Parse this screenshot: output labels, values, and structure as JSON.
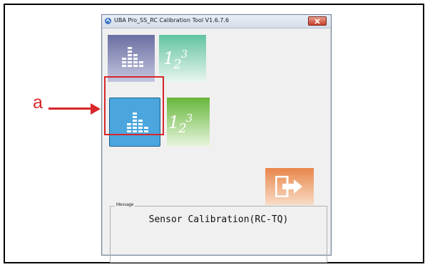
{
  "window": {
    "title": "UBA Pro_SS_RC Calibration Tool V1.6.7.6",
    "close_icon": "close-icon"
  },
  "tiles": [
    {
      "name": "sensor-calibration-tile-rc-tc",
      "icon": "bar-chart-icon"
    },
    {
      "name": "numeric-tile-rc-tc",
      "icon": "number-123-icon",
      "text": "123"
    },
    {
      "name": "sensor-calibration-tile-rc-tq",
      "icon": "bar-chart-icon",
      "selected": true
    },
    {
      "name": "numeric-tile-rc-tq",
      "icon": "number-123-icon",
      "text": "123"
    },
    {
      "name": "exit-tile",
      "icon": "exit-icon"
    }
  ],
  "message": {
    "legend": "Message",
    "text": "Sensor Calibration(RC-TQ)"
  },
  "annotation": {
    "label": "a"
  },
  "colors": {
    "highlight": "#d8262a",
    "tile_blue": "#4aa6dd",
    "tile_green": "#66b63a",
    "tile_teal": "#62c39f",
    "tile_orange": "#e9864a",
    "tile_purple": "#6a6ea2"
  }
}
